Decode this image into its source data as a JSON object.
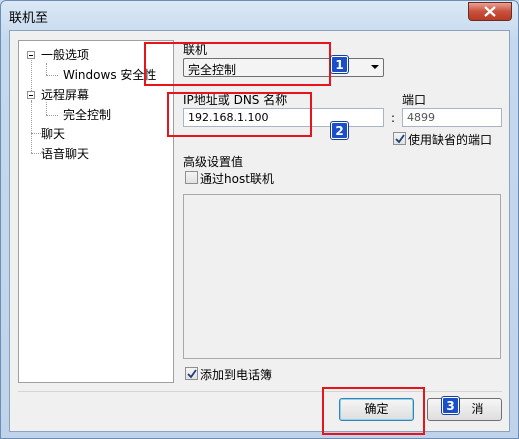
{
  "window": {
    "title": "联机至"
  },
  "tree": {
    "items": [
      {
        "label": "一般选项",
        "level": 0,
        "expanded": true
      },
      {
        "label": "Windows 安全性",
        "level": 1
      },
      {
        "label": "远程屏幕",
        "level": 0,
        "expanded": true
      },
      {
        "label": "完全控制",
        "level": 1
      },
      {
        "label": "聊天",
        "level": 0
      },
      {
        "label": "语音聊天",
        "level": 0
      }
    ]
  },
  "connect": {
    "label": "联机",
    "selected": "完全控制"
  },
  "address": {
    "label": "IP地址或 DNS 名称",
    "value": "192.168.1.100"
  },
  "port": {
    "label": "端口",
    "separator": ":",
    "value": "4899",
    "use_default_label": "使用缺省的端口",
    "use_default_checked": true
  },
  "advanced": {
    "label": "高级设置值",
    "via_host_label": "通过host联机",
    "via_host_checked": false
  },
  "phonebook": {
    "label": "添加到电话簿",
    "checked": true
  },
  "buttons": {
    "ok": "确定",
    "cancel": "消"
  },
  "annotations": {
    "badge1": "1",
    "badge2": "2",
    "badge3": "3",
    "highlight_color": "#e8141b",
    "badge_color": "#1a4fc9"
  }
}
